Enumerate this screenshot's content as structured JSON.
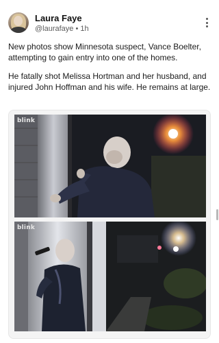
{
  "post": {
    "author_name": "Laura Faye",
    "author_handle": "@laurafaye",
    "separator": "•",
    "time": "1h",
    "paragraphs": [
      "New photos show Minnesota suspect, Vance Boelter, attempting to gain entry into one of the homes.",
      "He fatally shot Melissa Hortman and her husband, and injured John Hoffman and his wife. He remains at large."
    ]
  },
  "media": {
    "watermark_1": "blink",
    "watermark_2": "blink"
  },
  "icons": {
    "more": "more-vertical-icon"
  }
}
